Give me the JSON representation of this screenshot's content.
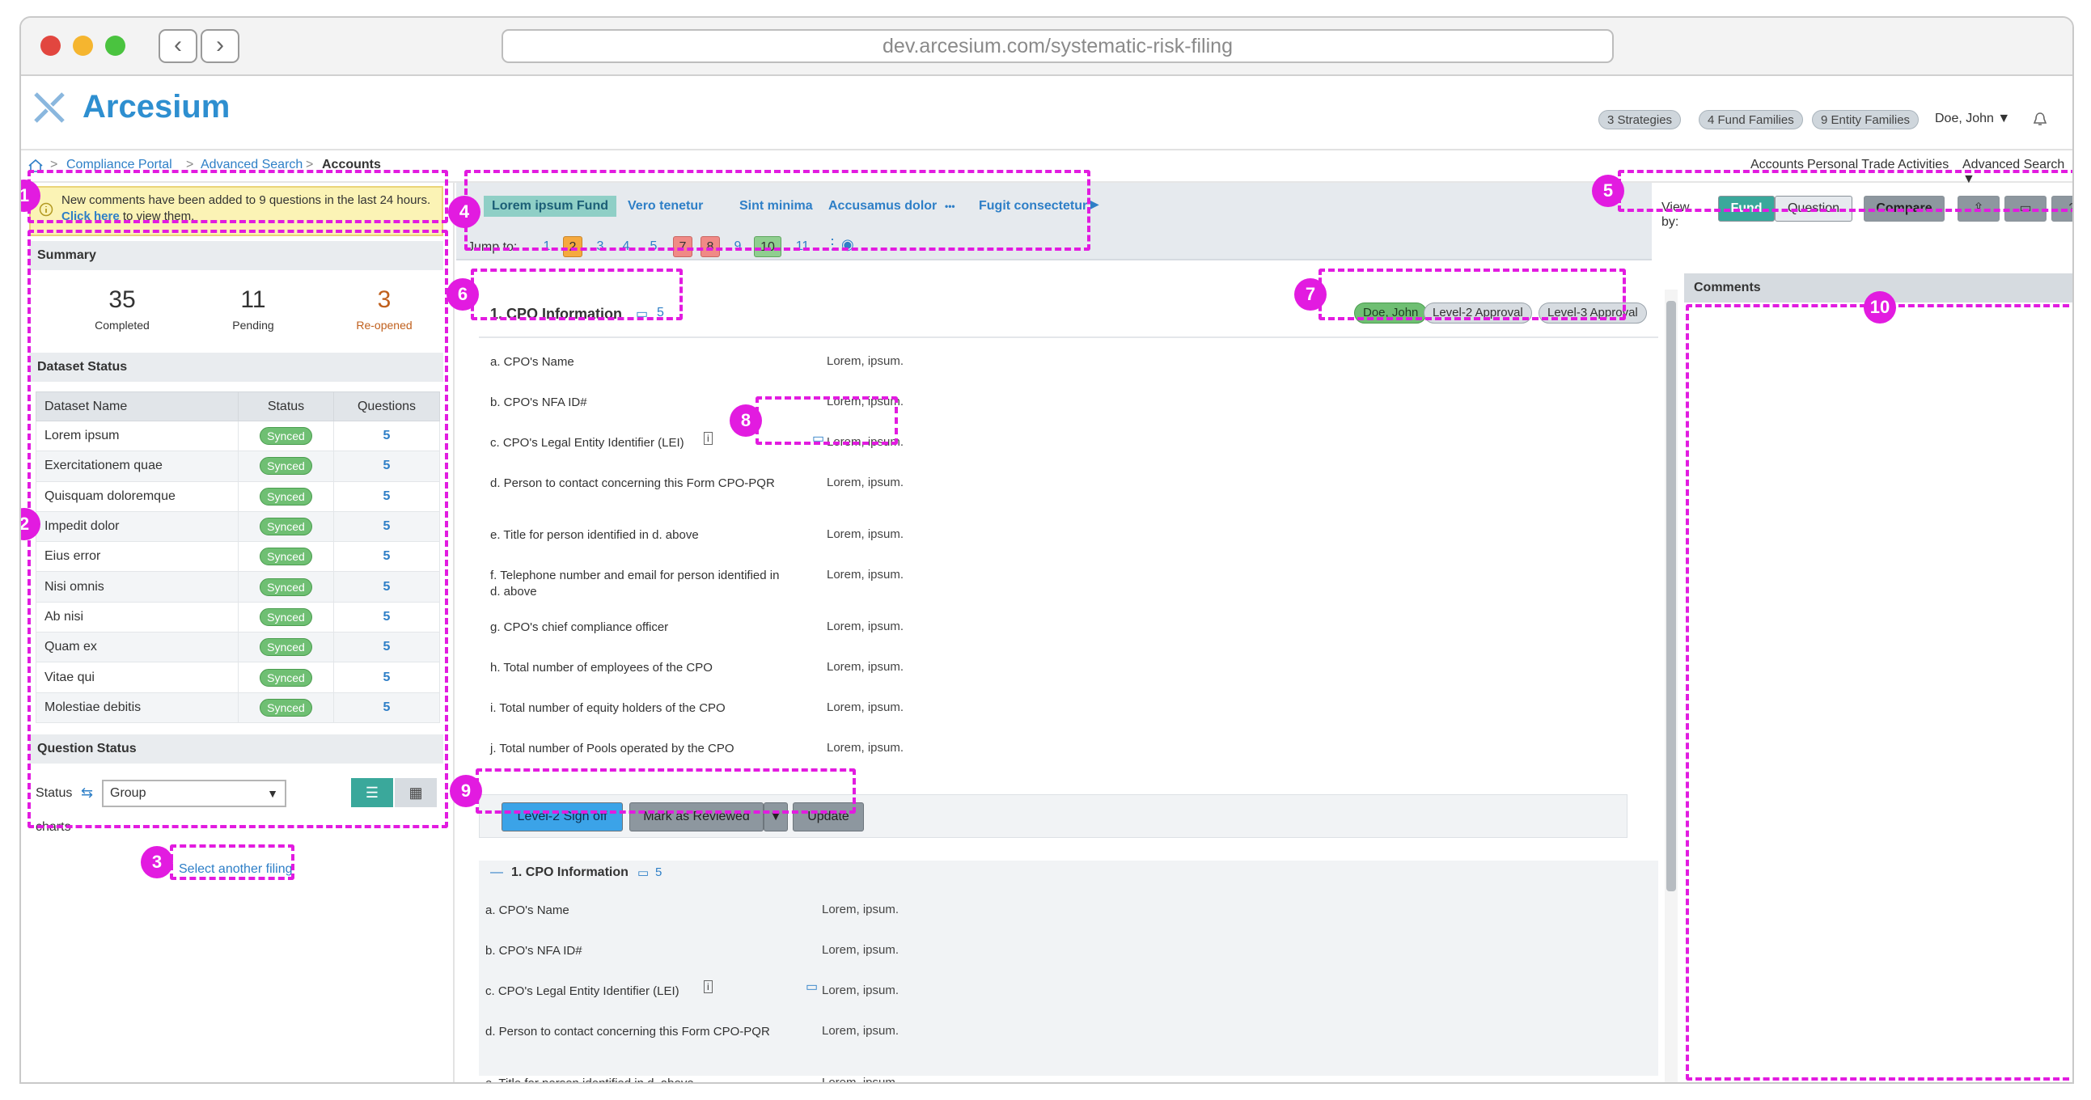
{
  "browser": {
    "url": "dev.arcesium.com/systematic-risk-filing"
  },
  "app": {
    "name": "Arcesium"
  },
  "header": {
    "strategies": "3 Strategies",
    "fund_families": "4 Fund Families",
    "entity_families": "9 Entity Families",
    "user": "Doe, John ▼"
  },
  "breadcrumb": {
    "portal": "Compliance Portal",
    "search": "Advanced Search",
    "current": "Accounts",
    "sep": ">"
  },
  "topnav": {
    "accounts": "Accounts",
    "pta": "Personal Trade Activities",
    "adv": "Advanced Search ▼"
  },
  "banner": {
    "text": "New comments have been added to 9 questions in the last 24 hours.",
    "link": "Click here",
    "suffix": "to view them."
  },
  "summary": {
    "title": "Summary",
    "completed_n": "35",
    "completed_l": "Completed",
    "pending_n": "11",
    "pending_l": "Pending",
    "reopened_n": "3",
    "reopened_l": "Re-opened"
  },
  "dataset": {
    "title": "Dataset Status",
    "headers": [
      "Dataset Name",
      "Status",
      "Questions"
    ],
    "rows": [
      {
        "name": "Lorem ipsum",
        "status": "Synced",
        "q": "5"
      },
      {
        "name": "Exercitationem quae",
        "status": "Synced",
        "q": "5"
      },
      {
        "name": "Quisquam doloremque",
        "status": "Synced",
        "q": "5"
      },
      {
        "name": "Impedit dolor",
        "status": "Synced",
        "q": "5"
      },
      {
        "name": "Eius error",
        "status": "Synced",
        "q": "5"
      },
      {
        "name": "Nisi omnis",
        "status": "Synced",
        "q": "5"
      },
      {
        "name": "Ab nisi",
        "status": "Synced",
        "q": "5"
      },
      {
        "name": "Quam ex",
        "status": "Synced",
        "q": "5"
      },
      {
        "name": "Vitae qui",
        "status": "Synced",
        "q": "5"
      },
      {
        "name": "Molestiae debitis",
        "status": "Synced",
        "q": "5"
      }
    ]
  },
  "qstatus": {
    "title": "Question Status",
    "status_label": "Status",
    "group": "Group",
    "charts": "charts"
  },
  "select_another": "Select another filing",
  "funds": [
    "Lorem ipsum Fund",
    "Vero tenetur",
    "Sint minima",
    "Accusamus dolor",
    "Fugit consectetur"
  ],
  "fund_more": "•••",
  "jump": {
    "label": "Jump to:",
    "pages": [
      "1",
      "2",
      "3",
      "4",
      "5",
      "7",
      "8",
      "9",
      "10",
      "11"
    ]
  },
  "viewby": {
    "label": "View by:",
    "fund": "Fund",
    "question": "Question",
    "compare": "Compare"
  },
  "section": {
    "title": "1. CPO Information",
    "comment_count": "5"
  },
  "approvals": [
    "Doe, John",
    "Level-2 Approval",
    "Level-3 Approval"
  ],
  "questions": [
    {
      "q": "a. CPO's Name",
      "a": "Lorem, ipsum."
    },
    {
      "q": "b. CPO's NFA ID#",
      "a": "Lorem, ipsum."
    },
    {
      "q": "c. CPO's Legal Entity Identifier (LEI)",
      "a": "Lorem, ipsum."
    },
    {
      "q": "d. Person to contact concerning this Form CPO-PQR",
      "a": "Lorem, ipsum."
    },
    {
      "q": "e. Title for person identified in d. above",
      "a": "Lorem, ipsum."
    },
    {
      "q": "f. Telephone number and email for person identified in d. above",
      "a": "Lorem, ipsum."
    },
    {
      "q": "g. CPO's chief compliance officer",
      "a": "Lorem, ipsum."
    },
    {
      "q": "h. Total number of employees of the CPO",
      "a": "Lorem, ipsum."
    },
    {
      "q": "i. Total number of equity holders of the CPO",
      "a": "Lorem, ipsum."
    },
    {
      "q": "j. Total number of Pools operated by the CPO",
      "a": "Lorem, ipsum."
    }
  ],
  "actions": {
    "signoff": "Level-2 Sign off",
    "reviewed": "Mark as Reviewed",
    "update": "Update"
  },
  "section2": {
    "title": "1. CPO Information",
    "comment_count": "5"
  },
  "questions2": [
    {
      "q": "a. CPO's Name",
      "a": "Lorem, ipsum."
    },
    {
      "q": "b. CPO's NFA ID#",
      "a": "Lorem, ipsum."
    },
    {
      "q": "c. CPO's Legal Entity Identifier (LEI)",
      "a": "Lorem, ipsum."
    },
    {
      "q": "d. Person to contact concerning this Form CPO-PQR",
      "a": "Lorem, ipsum."
    },
    {
      "q": "e. Title for person identified in d. above",
      "a": "Lorem, ipsum."
    }
  ],
  "comments": {
    "title": "Comments"
  },
  "annotations": [
    "1",
    "2",
    "3",
    "4",
    "5",
    "6",
    "7",
    "8",
    "9",
    "10"
  ],
  "colors": {
    "accent": "#2e7fc7",
    "annotation": "#e21be0",
    "synced": "#6fbf73",
    "fund_active": "#3aa89b",
    "signoff": "#3ba3e8"
  }
}
